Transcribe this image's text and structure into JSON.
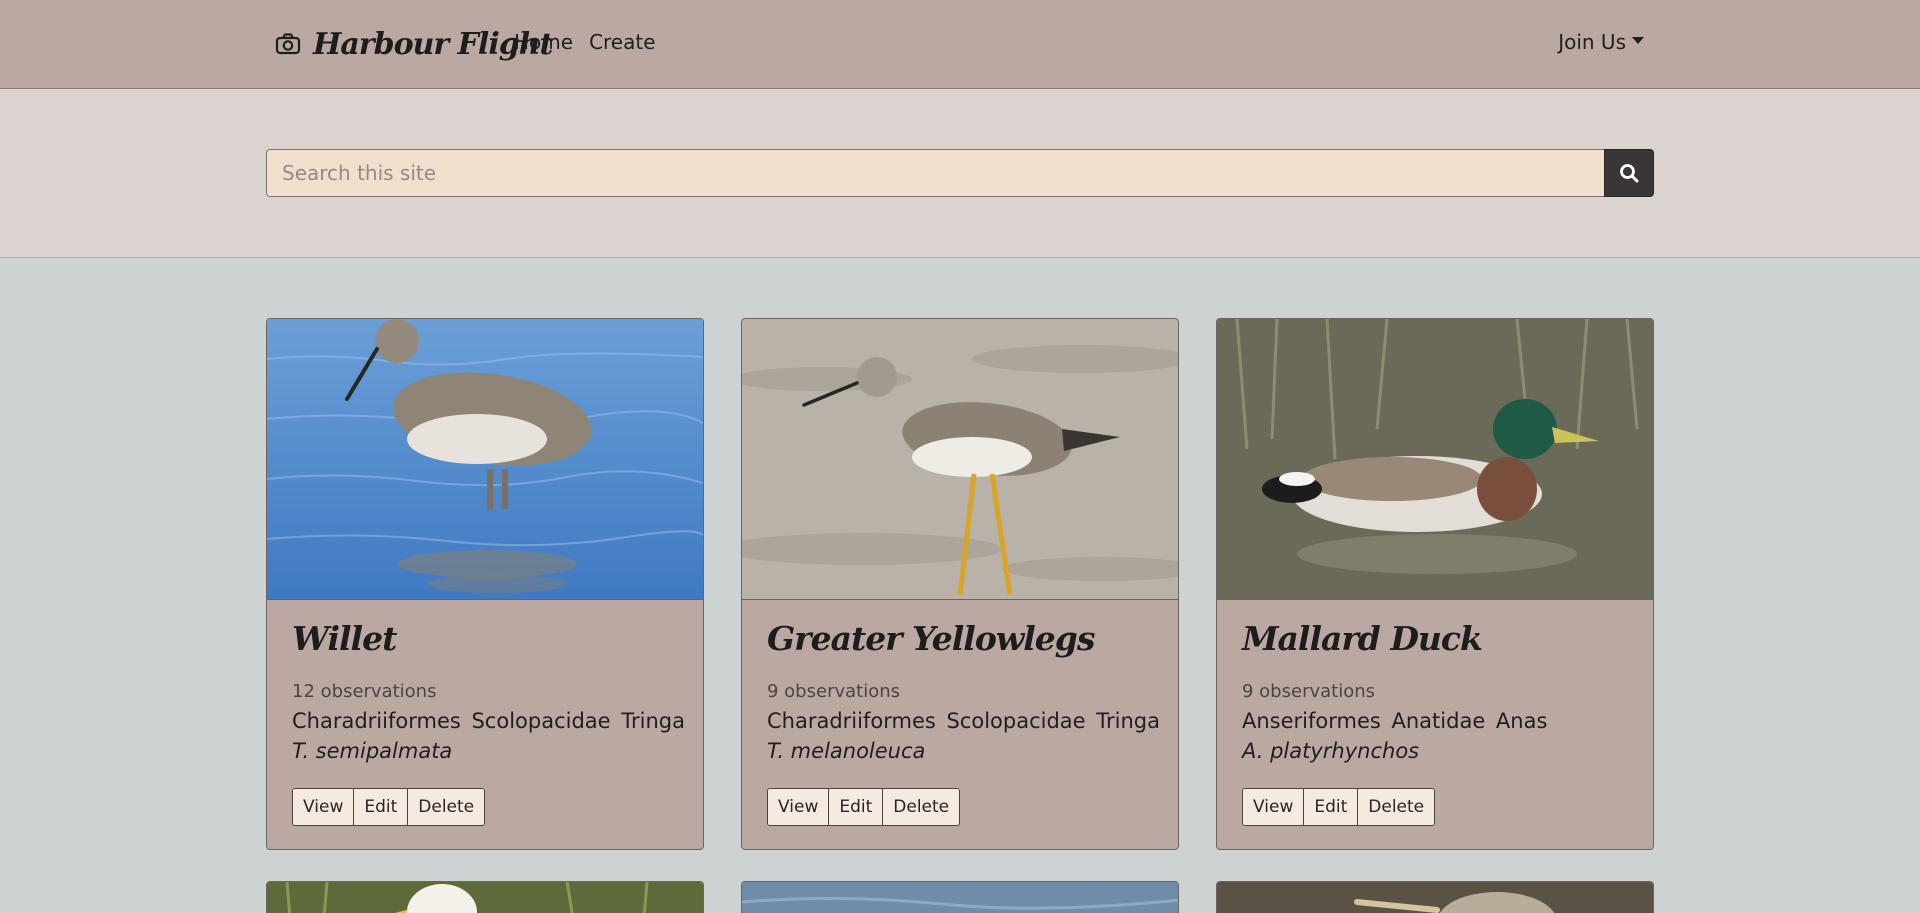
{
  "navbar": {
    "brand": "Harbour Flight",
    "brand_icon": "camera-icon",
    "links": [
      "Home",
      "Create"
    ],
    "join": "Join Us"
  },
  "search": {
    "placeholder": "Search this site",
    "button_icon": "search-icon"
  },
  "cards": [
    {
      "title": "Willet",
      "count": "12 observations",
      "taxon": "Charadriiformes Scolopacidae Tringa",
      "species": "T. semipalmata",
      "buttons": [
        "View",
        "Edit",
        "Delete"
      ]
    },
    {
      "title": "Greater Yellowlegs",
      "count": "9 observations",
      "taxon": "Charadriiformes Scolopacidae Tringa",
      "species": "T. melanoleuca",
      "buttons": [
        "View",
        "Edit",
        "Delete"
      ]
    },
    {
      "title": "Mallard Duck",
      "count": "9 observations",
      "taxon": "Anseriformes Anatidae Anas",
      "species": "A. platyrhynchos",
      "buttons": [
        "View",
        "Edit",
        "Delete"
      ]
    }
  ],
  "colors": {
    "navbar": "#bba8a3",
    "search_band": "#dbd3cf",
    "page_bg": "#cdd3d3",
    "search_input": "#f0dfcd",
    "search_button": "#3b3636",
    "card_bg": "#bba8a3"
  }
}
